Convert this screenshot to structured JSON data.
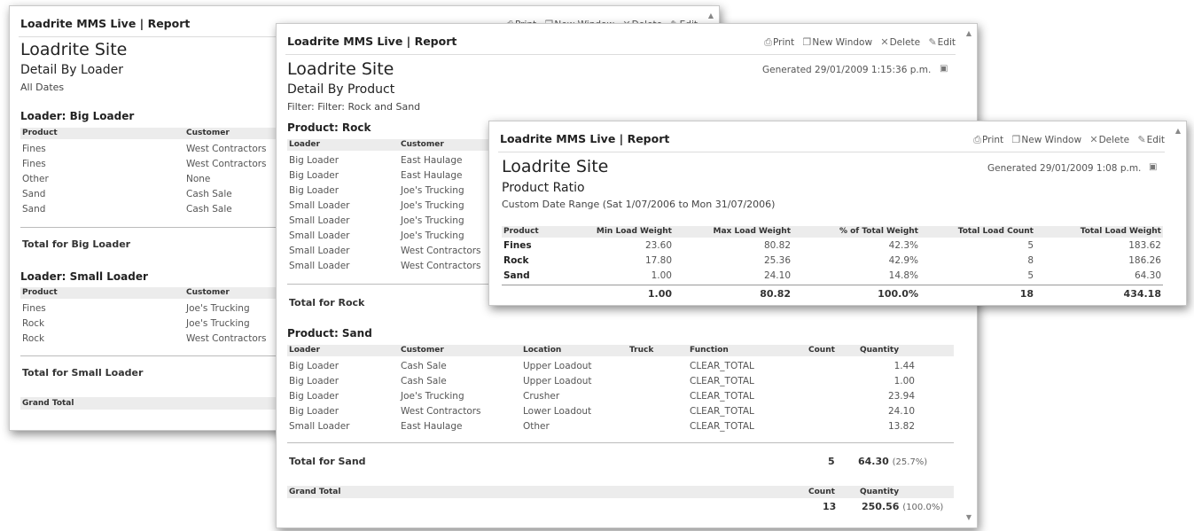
{
  "app_title": "Loadrite MMS Live | Report",
  "actions": {
    "print": "Print",
    "new_window": "New Window",
    "delete": "Delete",
    "edit": "Edit"
  },
  "site_name": "Loadrite Site",
  "report1": {
    "title": "Detail By Loader",
    "filter": "All Dates",
    "columns": [
      "Product",
      "Customer"
    ],
    "groups": [
      {
        "heading": "Loader: Big Loader",
        "rows": [
          [
            "Fines",
            "West Contractors"
          ],
          [
            "Fines",
            "West Contractors"
          ],
          [
            "Other",
            "None"
          ],
          [
            "Sand",
            "Cash Sale"
          ],
          [
            "Sand",
            "Cash Sale"
          ]
        ],
        "total_label": "Total for Big Loader"
      },
      {
        "heading": "Loader: Small Loader",
        "rows": [
          [
            "Fines",
            "Joe's Trucking"
          ],
          [
            "Rock",
            "Joe's Trucking"
          ],
          [
            "Rock",
            "West Contractors"
          ]
        ],
        "total_label": "Total for Small Loader"
      }
    ],
    "grand_total_label": "Grand Total"
  },
  "report2": {
    "title": "Detail By Product",
    "filter": "Filter: Filter: Rock and Sand",
    "generated": "Generated 29/01/2009 1:15:36 p.m.",
    "rock": {
      "heading": "Product: Rock",
      "columns": [
        "Loader",
        "Customer"
      ],
      "rows": [
        [
          "Big Loader",
          "East Haulage"
        ],
        [
          "Big Loader",
          "East Haulage"
        ],
        [
          "Big Loader",
          "Joe's Trucking"
        ],
        [
          "Small Loader",
          "Joe's Trucking"
        ],
        [
          "Small Loader",
          "Joe's Trucking"
        ],
        [
          "Small Loader",
          "Joe's Trucking"
        ],
        [
          "Small Loader",
          "West Contractors"
        ],
        [
          "Small Loader",
          "West Contractors"
        ]
      ],
      "total_label": "Total for Rock"
    },
    "sand": {
      "heading": "Product: Sand",
      "columns": [
        "Loader",
        "Customer",
        "Location",
        "Truck",
        "Function",
        "Count",
        "Quantity"
      ],
      "rows": [
        [
          "Big Loader",
          "Cash Sale",
          "Upper Loadout",
          "",
          "CLEAR_TOTAL",
          "",
          "1.44"
        ],
        [
          "Big Loader",
          "Cash Sale",
          "Upper Loadout",
          "",
          "CLEAR_TOTAL",
          "",
          "1.00"
        ],
        [
          "Big Loader",
          "Joe's Trucking",
          "Crusher",
          "",
          "CLEAR_TOTAL",
          "",
          "23.94"
        ],
        [
          "Big Loader",
          "West Contractors",
          "Lower Loadout",
          "",
          "CLEAR_TOTAL",
          "",
          "24.10"
        ],
        [
          "Small Loader",
          "East Haulage",
          "Other",
          "",
          "CLEAR_TOTAL",
          "",
          "13.82"
        ]
      ],
      "total_label": "Total for Sand",
      "total_count": "5",
      "total_quantity": "64.30",
      "total_pct": "(25.7%)"
    },
    "grand_total": {
      "label": "Grand Total",
      "count_header": "Count",
      "quantity_header": "Quantity",
      "count": "13",
      "quantity": "250.56",
      "pct": "(100.0%)"
    }
  },
  "report3": {
    "title": "Product Ratio",
    "filter": "Custom Date Range (Sat 1/07/2006 to Mon 31/07/2006)",
    "generated": "Generated 29/01/2009 1:08 p.m.",
    "columns": [
      "Product",
      "Min Load Weight",
      "Max Load Weight",
      "% of Total Weight",
      "Total Load Count",
      "Total Load Weight"
    ],
    "rows": [
      [
        "Fines",
        "23.60",
        "80.82",
        "42.3%",
        "5",
        "183.62"
      ],
      [
        "Rock",
        "17.80",
        "25.36",
        "42.9%",
        "8",
        "186.26"
      ],
      [
        "Sand",
        "1.00",
        "24.10",
        "14.8%",
        "5",
        "64.30"
      ]
    ],
    "totals": [
      "",
      "1.00",
      "80.82",
      "100.0%",
      "18",
      "434.18"
    ]
  }
}
